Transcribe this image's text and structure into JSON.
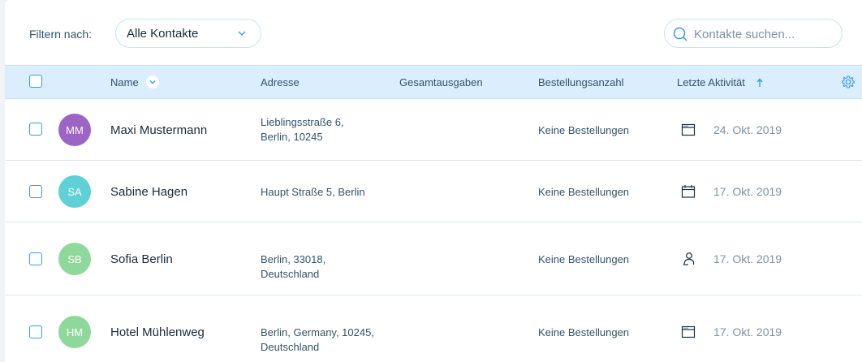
{
  "filter": {
    "label": "Filtern nach:",
    "selected": "Alle Kontakte"
  },
  "search": {
    "placeholder": "Kontakte suchen..."
  },
  "table": {
    "columns": {
      "name": "Name",
      "address": "Adresse",
      "total": "Gesamtausgaben",
      "orders": "Bestellungsanzahl",
      "activity": "Letzte Aktivität"
    },
    "rows": [
      {
        "initials": "MM",
        "avatar_color": "#9b64c5",
        "name": "Maxi Mustermann",
        "address_line1": "Lieblingsstraße 6,",
        "address_line2": "Berlin, 10245",
        "orders": "Keine Bestellungen",
        "activity_icon": "browser-window-icon",
        "date": "24. Okt. 2019"
      },
      {
        "initials": "SA",
        "avatar_color": "#5fd0d6",
        "name": "Sabine Hagen",
        "address_line1": "Haupt Straße 5, Berlin",
        "address_line2": "",
        "orders": "Keine Bestellungen",
        "activity_icon": "calendar-icon",
        "date": "17. Okt. 2019"
      },
      {
        "initials": "SB",
        "avatar_color": "#8fd89c",
        "name": "Sofia Berlin",
        "address_line1": "Berlin, 33018,",
        "address_line2": "Deutschland",
        "orders": "Keine Bestellungen",
        "activity_icon": "contact-person-icon",
        "date": "17. Okt. 2019"
      },
      {
        "initials": "HM",
        "avatar_color": "#8fd89c",
        "name": "Hotel Mühlenweg",
        "address_line1": "Berlin, Germany, 10245,",
        "address_line2": "Deutschland",
        "orders": "Keine Bestellungen",
        "activity_icon": "browser-window-icon",
        "date": "17. Okt. 2019"
      }
    ]
  },
  "colors": {
    "accent": "#3899ec",
    "header_bg": "#daeefd",
    "border": "#c1e4fe"
  }
}
